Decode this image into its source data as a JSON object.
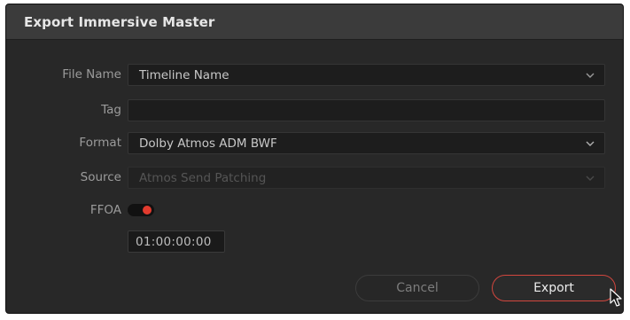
{
  "dialog": {
    "title": "Export Immersive Master"
  },
  "fields": {
    "file_name": {
      "label": "File Name",
      "value": "Timeline Name"
    },
    "tag": {
      "label": "Tag",
      "value": ""
    },
    "format": {
      "label": "Format",
      "value": "Dolby Atmos ADM BWF"
    },
    "source": {
      "label": "Source",
      "value": "Atmos Send Patching",
      "disabled": true
    },
    "ffoa": {
      "label": "FFOA",
      "enabled": true,
      "timecode": "01:00:00:00"
    }
  },
  "buttons": {
    "cancel_label": "Cancel",
    "export_label": "Export"
  },
  "colors": {
    "accent": "#e23b2e",
    "dialog_bg": "#282828",
    "titlebar_bg": "#3b3b3b"
  },
  "icons": {
    "dropdown": "chevron-down-icon",
    "cursor": "mouse-pointer-icon"
  }
}
